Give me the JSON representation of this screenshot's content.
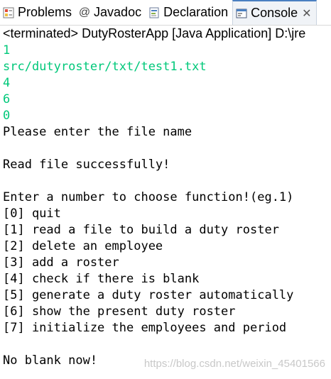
{
  "tabs": [
    {
      "label": "Problems",
      "icon": "problems-icon"
    },
    {
      "label": "Javadoc",
      "icon": "at-icon"
    },
    {
      "label": "Declaration",
      "icon": "declaration-icon"
    },
    {
      "label": "Console",
      "icon": "console-icon",
      "active": true
    }
  ],
  "status": "<terminated> DutyRosterApp [Java Application] D:\\jre",
  "console_lines": [
    {
      "text": "1",
      "kind": "in"
    },
    {
      "text": "src/dutyroster/txt/test1.txt",
      "kind": "in"
    },
    {
      "text": "4",
      "kind": "in"
    },
    {
      "text": "6",
      "kind": "in"
    },
    {
      "text": "0",
      "kind": "in"
    },
    {
      "text": "Please enter the file name",
      "kind": "out"
    },
    {
      "text": "",
      "kind": "out"
    },
    {
      "text": "Read file successfully!",
      "kind": "out"
    },
    {
      "text": "",
      "kind": "out"
    },
    {
      "text": "Enter a number to choose function!(eg.1)",
      "kind": "out"
    },
    {
      "text": "[0] quit",
      "kind": "out"
    },
    {
      "text": "[1] read a file to build a duty roster",
      "kind": "out"
    },
    {
      "text": "[2] delete an employee",
      "kind": "out"
    },
    {
      "text": "[3] add a roster",
      "kind": "out"
    },
    {
      "text": "[4] check if there is blank",
      "kind": "out"
    },
    {
      "text": "[5] generate a duty roster automatically",
      "kind": "out"
    },
    {
      "text": "[6] show the present duty roster",
      "kind": "out"
    },
    {
      "text": "[7] initialize the employees and period",
      "kind": "out"
    },
    {
      "text": "",
      "kind": "out"
    },
    {
      "text": "No blank now!",
      "kind": "out"
    }
  ],
  "watermark": "https://blog.csdn.net/weixin_45401566",
  "colors": {
    "input_text": "#00c87a",
    "output_text": "#000000",
    "active_tab_border": "#4a7fc1"
  }
}
